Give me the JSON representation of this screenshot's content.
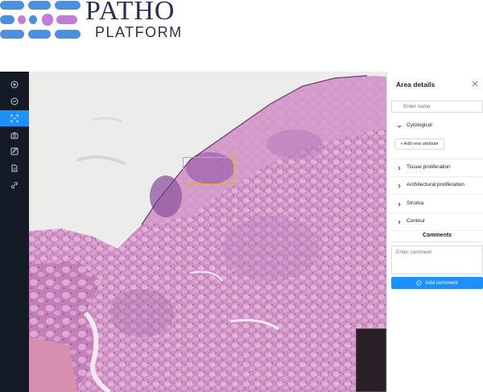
{
  "logo": {
    "line1": "PATHO",
    "line2": "PLATFORM",
    "colors": {
      "blue": "#4a8fe0",
      "purple": "#c27bd6",
      "navy": "#2b2e57"
    }
  },
  "toolbar": {
    "items": [
      {
        "icon": "zoom-in-icon",
        "active": false
      },
      {
        "icon": "zoom-out-icon",
        "active": false
      },
      {
        "icon": "select-area-icon",
        "active": true
      },
      {
        "icon": "camera-icon",
        "active": false
      },
      {
        "icon": "edit-icon",
        "active": false
      },
      {
        "icon": "document-icon",
        "active": false
      },
      {
        "icon": "link-icon",
        "active": false
      }
    ]
  },
  "panel": {
    "title": "Area details",
    "name_placeholder": "Enter name",
    "sections": [
      {
        "label": "Cytological",
        "expanded": true
      },
      {
        "label": "Tissue proliferation",
        "expanded": false
      },
      {
        "label": "Architectural proliferation",
        "expanded": false
      },
      {
        "label": "Stroma",
        "expanded": false
      },
      {
        "label": "Contour",
        "expanded": false
      }
    ],
    "add_attribute_label": "+ Add new attribute",
    "comments_title": "Comments",
    "comment_placeholder": "Enter comment",
    "add_comment_label": "Add comment"
  },
  "colors": {
    "accent": "#1e90ff",
    "toolbar_bg": "#151b26",
    "selection": "#e0a84a"
  }
}
